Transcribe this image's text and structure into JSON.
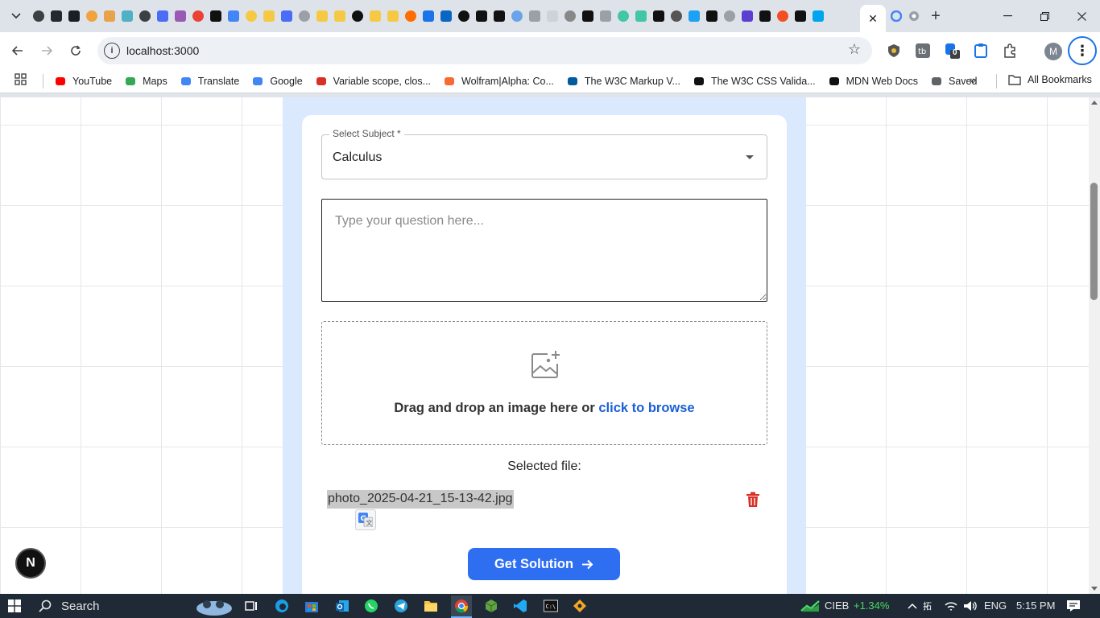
{
  "browser": {
    "active_tab_close": "✕",
    "new_tab": "+",
    "url": "localhost:3000",
    "profile_initial": "M",
    "extension_badge": "0"
  },
  "bookmarks": [
    {
      "label": "YouTube",
      "icon": "youtube-icon",
      "color": "#ff0000"
    },
    {
      "label": "Maps",
      "icon": "maps-icon",
      "color": "#34a853"
    },
    {
      "label": "Translate",
      "icon": "translate-icon",
      "color": "#4285f4"
    },
    {
      "label": "Google",
      "icon": "google-icon",
      "color": "#4285f4"
    },
    {
      "label": "Variable scope, clos...",
      "icon": "mdn-icon",
      "color": "#d93025"
    },
    {
      "label": "Wolfram|Alpha: Co...",
      "icon": "wolfram-icon",
      "color": "#f96932"
    },
    {
      "label": "The W3C Markup V...",
      "icon": "w3c-icon",
      "color": "#005a9c"
    },
    {
      "label": "The W3C CSS Valida...",
      "icon": "w3c-css-icon",
      "color": "#111111"
    },
    {
      "label": "MDN Web Docs",
      "icon": "mdn-web-docs-icon",
      "color": "#111111"
    },
    {
      "label": "Saved",
      "icon": "globe-icon",
      "color": "#5f6368"
    }
  ],
  "all_bookmarks": "All Bookmarks",
  "form": {
    "subject_label": "Select Subject *",
    "subject_value": "Calculus",
    "question_placeholder": "Type your question here...",
    "dropzone_text": "Drag and drop an image here or",
    "dropzone_link": "click to browse",
    "selected_file_label": "Selected file:",
    "file_name": "photo_2025-04-21_15-13-42.jpg",
    "submit_label": "Get Solution"
  },
  "next_badge": "N",
  "taskbar": {
    "search": "Search",
    "ticker": "CIEB",
    "ticker_change": "+1.34%",
    "language": "ENG",
    "time": "5:15 PM"
  },
  "colors": {
    "accent": "#2e6ff2",
    "link": "#1a5fd6",
    "panel": "#dbe9fe",
    "delete": "#d93025",
    "ticker_up": "#4cd964"
  }
}
